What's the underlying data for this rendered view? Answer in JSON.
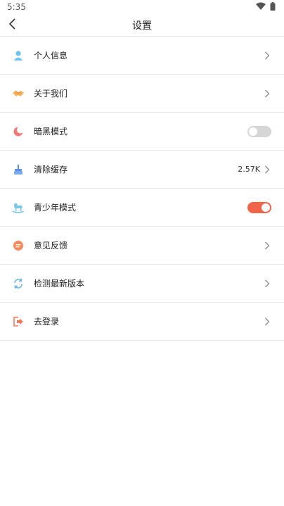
{
  "status_bar": {
    "time": "5:35"
  },
  "header": {
    "title": "设置"
  },
  "settings": {
    "profile_label": "个人信息",
    "about_label": "关于我们",
    "dark_mode_label": "暗黑模式",
    "dark_mode_on": false,
    "clear_cache_label": "清除缓存",
    "cache_size": "2.57K",
    "youth_mode_label": "青少年模式",
    "youth_mode_on": true,
    "feedback_label": "意见反馈",
    "check_update_label": "检测最新版本",
    "login_label": "去登录"
  },
  "colors": {
    "accent": "#f0654a",
    "toggle_off": "#d6d6d6",
    "divider": "#e6e6e6"
  }
}
